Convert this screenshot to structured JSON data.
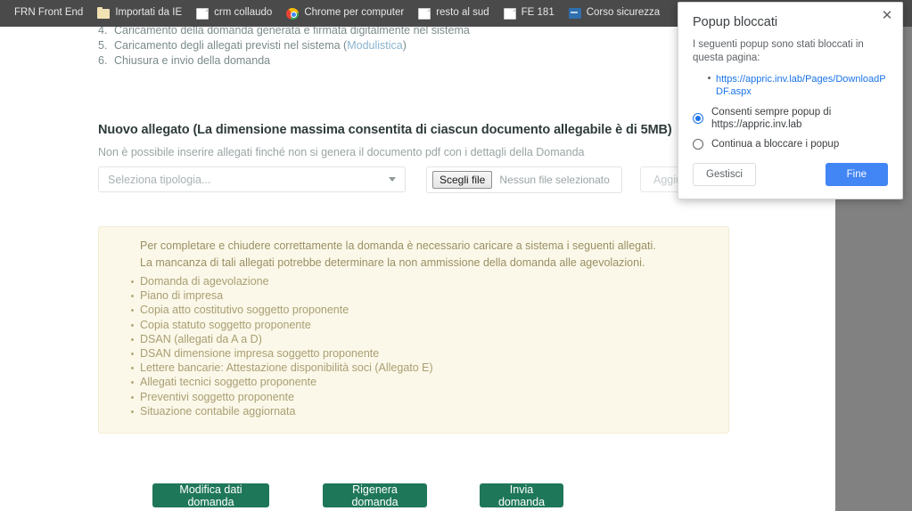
{
  "browser": {
    "bookmarks": [
      {
        "label": "FRN Front End",
        "icon": "none"
      },
      {
        "label": "Importati da IE",
        "icon": "folder-icon"
      },
      {
        "label": "crm collaudo",
        "icon": "page-icon"
      },
      {
        "label": "Chrome per computer",
        "icon": "chrome-icon"
      },
      {
        "label": "resto al sud",
        "icon": "page-icon"
      },
      {
        "label": "FE 181",
        "icon": "page-icon"
      },
      {
        "label": "Corso sicurezza",
        "icon": "blue-square-icon"
      }
    ]
  },
  "content": {
    "steps": [
      {
        "num": "4.",
        "text": "Caricamento della domanda generata e firmata digitalmente nel sistema",
        "link": ""
      },
      {
        "num": "5.",
        "text": "Caricamento degli allegati previsti nel sistema (",
        "link": "Modulistica",
        "suffix": ")"
      },
      {
        "num": "6.",
        "text": "Chiusura e invio della domanda",
        "link": ""
      }
    ],
    "heading": "Nuovo allegato (La dimensione massima consentita di ciascun documento allegabile è di 5MB)",
    "subnote": "Non è possibile inserire allegati finché non si genera il documento pdf con i dettagli della Domanda",
    "form": {
      "select_placeholder": "Seleziona tipologia...",
      "file_button": "Scegli file",
      "file_status": "Nessun file selezionato",
      "add_button": "Aggiungi"
    },
    "alert": {
      "line1": "Per completare e chiudere correttamente la domanda è necessario caricare a sistema i seguenti allegati.",
      "line2": "La mancanza di tali allegati potrebbe determinare la non ammissione della domanda alle agevolazioni.",
      "items": [
        "Domanda di agevolazione",
        "Piano di impresa",
        "Copia atto costitutivo soggetto proponente",
        "Copia statuto soggetto proponente",
        "DSAN (allegati da A a D)",
        "DSAN dimensione impresa soggetto proponente",
        "Lettere bancarie: Attestazione disponibilità soci (Allegato E)",
        "Allegati tecnici soggetto proponente",
        "Preventivi soggetto proponente",
        "Situazione contabile aggiornata"
      ]
    },
    "actions": {
      "modifica": "Modifica dati domanda",
      "rigenera": "Rigenera domanda",
      "invia": "Invia domanda"
    }
  },
  "popup": {
    "title": "Popup bloccati",
    "subtitle": "I seguenti popup sono stati bloccati in questa pagina:",
    "blocked_url": "https://appric.inv.lab/Pages/DownloadPDF.aspx",
    "option_allow": "Consenti sempre popup di https://appric.inv.lab",
    "option_block": "Continua a bloccare i popup",
    "selected_option": "allow",
    "manage_button": "Gestisci",
    "done_button": "Fine",
    "close_icon": "✕"
  },
  "colors": {
    "bookmark_bar": "#4a4a4a",
    "primary_green": "#1f775a",
    "alert_bg": "#fbf8e9",
    "chrome_blue": "#4285f4",
    "link_blue": "#1a73e8",
    "overlay_grey": "#818181"
  }
}
